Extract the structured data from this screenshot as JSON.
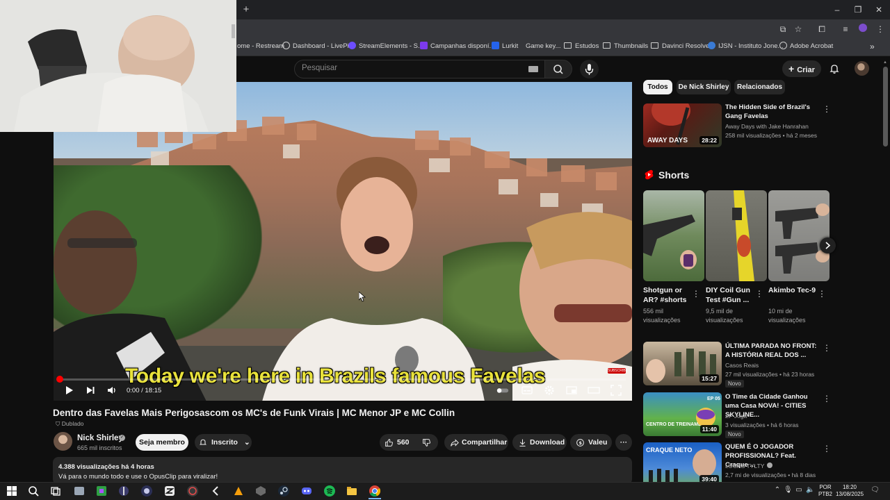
{
  "browser": {
    "bookmarks": [
      {
        "label": "ome - Restream",
        "color": "#3b82f6"
      },
      {
        "label": "Dashboard - LivePix",
        "color": "#d0d0d0"
      },
      {
        "label": "StreamElements - S...",
        "color": "#6d4dff"
      },
      {
        "label": "Campanhas disponí...",
        "color": "#7c3aed"
      },
      {
        "label": "Lurkit",
        "color": "#2563eb"
      },
      {
        "label": "Game key...",
        "color": "#999999"
      },
      {
        "label": "Estudos",
        "folder": true
      },
      {
        "label": "Thumbnails",
        "folder": true
      },
      {
        "label": "Davinci Resolve",
        "folder": true
      },
      {
        "label": "IJSN - Instituto Jone...",
        "color": "#3a7bd5"
      },
      {
        "label": "Adobe Acrobat",
        "color": "#cccccc"
      }
    ]
  },
  "header": {
    "search_placeholder": "Pesquisar",
    "create_label": "Criar"
  },
  "video": {
    "caption": "Today we're here in Brazils famous Favelas",
    "time": "0:00 / 18:15",
    "progress": 0.0,
    "subscribe_badge": "SUBSCRIBE",
    "title": "Dentro das Favelas Mais Perigosascom os MC's de Funk Virais | MC Menor JP e MC Collin",
    "dubbed": "Dublado"
  },
  "channel": {
    "name": "Nick Shirley",
    "subs": "665 mil inscritos",
    "join": "Seja membro",
    "subscribed": "Inscrito"
  },
  "actions": {
    "likes": "560",
    "share": "Compartilhar",
    "download": "Download",
    "thanks": "Valeu"
  },
  "description": {
    "stats": "4.388 visualizações  há 4 horas",
    "text": "Vá para o mundo todo e use o OpusClip para viralizar!"
  },
  "sidebar": {
    "chips": [
      "Todos",
      "De Nick Shirley",
      "Relacionados"
    ],
    "top_video": {
      "title": "The Hidden Side of Brazil's Gang Favelas",
      "channel": "Away Days with Jake Hanrahan",
      "meta": "258 mil visualizações • há 2 meses",
      "duration": "28:22",
      "thumb_text": "AWAY DAYS"
    },
    "shorts_title": "Shorts",
    "shorts": [
      {
        "title": "Shotgun or AR? #shorts",
        "views": "556 mil visualizações"
      },
      {
        "title": "DIY Coil Gun Test #Gun ...",
        "views": "9,5 mil de visualizações"
      },
      {
        "title": "Akimbo Tec-9",
        "views": "10 mi de visualizações"
      }
    ],
    "videos": [
      {
        "title": "ÚLTIMA PARADA NO FRONT: A HISTÓRIA REAL DOS ...",
        "channel": "Casos Reais",
        "meta": "27 mil visualizações • há 23 horas",
        "badge": "Novo",
        "duration": "15:27"
      },
      {
        "title": "O Time da Cidade Ganhou uma Casa NOVA! - CITIES SKYLINE...",
        "channel": "ZF Joga",
        "meta": "3 visualizações • há 6 horas",
        "badge": "Novo",
        "duration": "11:40",
        "thumb_text": "CENTRO DE TREINAMENTO",
        "thumb_ep": "EP 05"
      },
      {
        "title": "QUEM É O JOGADOR PROFISSIONAL? Feat. Craque ...",
        "channel": "LUCAS TYLTY",
        "meta": "2,7 mi de visualizações • há 8 dias",
        "duration": "39:40",
        "thumb_text": "CRAQUE NETO"
      }
    ]
  },
  "taskbar": {
    "lang_top": "POR",
    "lang_bottom": "PTB2",
    "time": "18:20",
    "date": "13/08/2025"
  },
  "colors": {
    "accent": "#ff0000",
    "caption": "#e8e13a",
    "background": "#0f0f0f"
  }
}
